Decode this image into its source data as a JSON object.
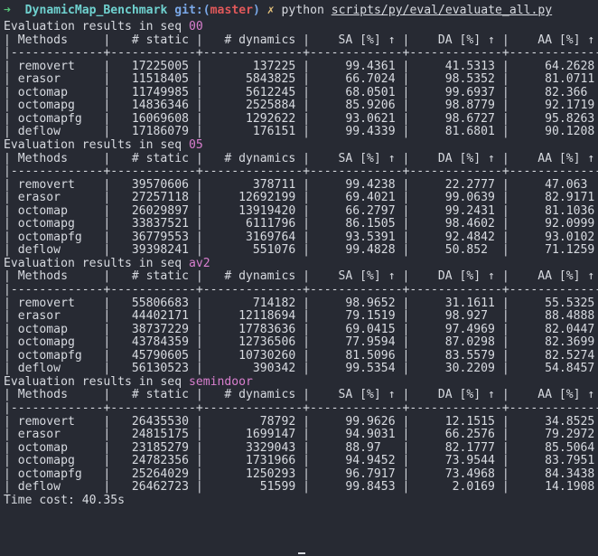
{
  "prompt": {
    "arrow": "➜",
    "dir": "DynamicMap_Benchmark",
    "git_label": "git:",
    "paren_open": "(",
    "branch": "master",
    "paren_close": ")",
    "dirty": "✗",
    "command": "python",
    "script_path": "scripts/py/eval/evaluate_all.py"
  },
  "eval_prefix": "Evaluation results in seq ",
  "table_header": "| Methods     |   # static |   # dynamics |    SA [%] ↑ |    DA [%] ↑ |    AA [%] ↑ |",
  "table_separator": "|-------------+------------+--------------+-------------+-------------+-------------|",
  "sequences": [
    {
      "seq": "00",
      "rows": [
        "| removert    |   17225005 |       137225 |     99.4361 |     41.5313 |     64.2628 |",
        "| erasor      |   11518405 |      5843825 |     66.7024 |     98.5352 |     81.0711 |",
        "| octomap     |   11749985 |      5612245 |     68.0501 |     99.6937 |     82.366  |",
        "| octomapg    |   14836346 |      2525884 |     85.9206 |     98.8779 |     92.1719 |",
        "| octomapfg   |   16069608 |      1292622 |     93.0621 |     98.6727 |     95.8263 |",
        "| deflow      |   17186079 |       176151 |     99.4339 |     81.6801 |     90.1208 |"
      ]
    },
    {
      "seq": "05",
      "rows": [
        "| removert    |   39570606 |       378711 |     99.4238 |     22.2777 |     47.063  |",
        "| erasor      |   27257118 |     12692199 |     69.4021 |     99.0639 |     82.9171 |",
        "| octomap     |   26029897 |     13919420 |     66.2797 |     99.2431 |     81.1036 |",
        "| octomapg    |   33837521 |      6111796 |     86.1505 |     98.4602 |     92.0999 |",
        "| octomapfg   |   36779553 |      3169764 |     93.5391 |     92.4842 |     93.0102 |",
        "| deflow      |   39398241 |       551076 |     99.4828 |     50.852  |     71.1259 |"
      ]
    },
    {
      "seq": "av2",
      "rows": [
        "| removert    |   55806683 |       714182 |     98.9652 |     31.1611 |     55.5325 |",
        "| erasor      |   44402171 |     12118694 |     79.1519 |     98.927  |     88.4888 |",
        "| octomap     |   38737229 |     17783636 |     69.0415 |     97.4969 |     82.0447 |",
        "| octomapg    |   43784359 |     12736506 |     77.9594 |     87.0298 |     82.3699 |",
        "| octomapfg   |   45790605 |     10730260 |     81.5096 |     83.5579 |     82.5274 |",
        "| deflow      |   56130523 |       390342 |     99.5354 |     30.2209 |     54.8457 |"
      ]
    },
    {
      "seq": "semindoor",
      "rows": [
        "| removert    |   26435530 |        78792 |     99.9626 |     12.1515 |     34.8525 |",
        "| erasor      |   24815175 |      1699147 |     94.9031 |     66.2576 |     79.2972 |",
        "| octomap     |   23185279 |      3329043 |     88.97   |     82.1777 |     85.5064 |",
        "| octomapg    |   24782356 |      1731966 |     94.9452 |     73.9544 |     83.7951 |",
        "| octomapfg   |   25264029 |      1250293 |     96.7917 |     73.4968 |     84.3438 |",
        "| deflow      |   26462723 |        51599 |     99.8453 |      2.0169 |     14.1908 |"
      ]
    }
  ],
  "footer": "Time cost: 40.35s",
  "colors": {
    "background": "#272a33",
    "text": "#d7dae0",
    "prompt_arrow": "#56c47a",
    "dir": "#6fd1cf",
    "branch": "#e0585a",
    "seq_name": "#d97fcf"
  }
}
